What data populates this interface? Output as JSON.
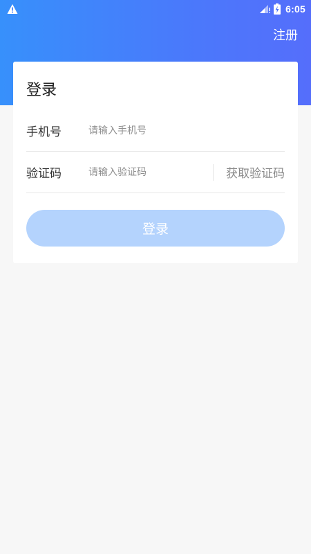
{
  "status_bar": {
    "time": "6:05",
    "icons": [
      "warning-icon",
      "signal-icon",
      "battery-charging-icon"
    ]
  },
  "header": {
    "register_label": "注册"
  },
  "login_card": {
    "title": "登录",
    "phone": {
      "label": "手机号",
      "placeholder": "请输入手机号",
      "value": ""
    },
    "code": {
      "label": "验证码",
      "placeholder": "请输入验证码",
      "value": "",
      "get_code_label": "获取验证码"
    },
    "submit_label": "登录"
  },
  "colors": {
    "header_gradient_start": "#3790fb",
    "header_gradient_end": "#556efb",
    "button_disabled": "#b4d3fd",
    "page_background": "#f7f7f7"
  }
}
